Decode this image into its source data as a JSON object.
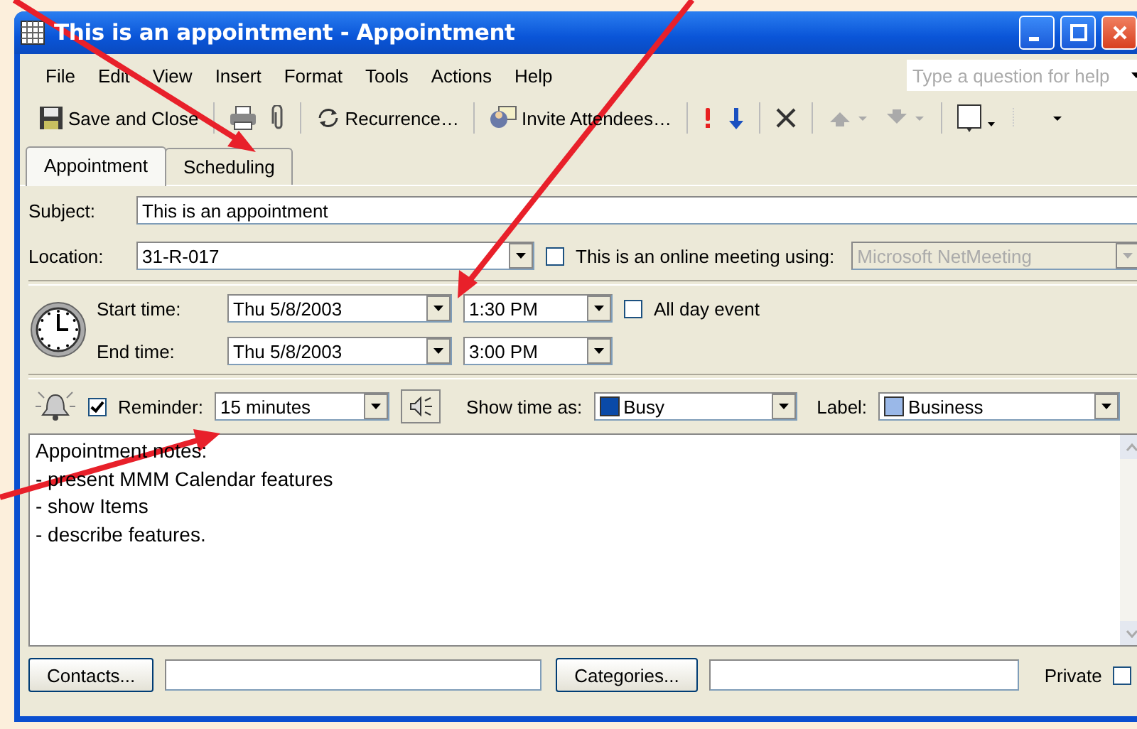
{
  "window": {
    "title": "This is an appointment - Appointment"
  },
  "menu": [
    "File",
    "Edit",
    "View",
    "Insert",
    "Format",
    "Tools",
    "Actions",
    "Help"
  ],
  "help_box": {
    "placeholder": "Type a question for help"
  },
  "toolbar": [
    {
      "kind": "save",
      "label": "Save and Close"
    },
    {
      "kind": "print"
    },
    {
      "kind": "attach"
    },
    {
      "kind": "recurrence",
      "label": "Recurrence…"
    },
    {
      "kind": "invite",
      "label": "Invite Attendees…"
    },
    {
      "kind": "high-importance"
    },
    {
      "kind": "low-importance"
    },
    {
      "kind": "delete"
    },
    {
      "kind": "previous",
      "disabled": true
    },
    {
      "kind": "next",
      "disabled": true
    },
    {
      "kind": "help"
    }
  ],
  "tabs": [
    {
      "label": "Appointment",
      "selected": true
    },
    {
      "label": "Scheduling",
      "selected": false
    }
  ],
  "subject": {
    "label": "Subject:",
    "value": "This is an appointment"
  },
  "location": {
    "label": "Location:",
    "value": "31-R-017"
  },
  "online_meeting": {
    "label": "This is an online meeting using:",
    "checked": false,
    "value": "Microsoft NetMeeting",
    "disabled": true
  },
  "start": {
    "label": "Start time:",
    "date": "Thu 5/8/2003",
    "time": "1:30 PM"
  },
  "end": {
    "label": "End time:",
    "date": "Thu 5/8/2003",
    "time": "3:00 PM"
  },
  "all_day": {
    "label": "All day event",
    "checked": false
  },
  "reminder": {
    "label": "Reminder:",
    "checked": true,
    "value": "15 minutes"
  },
  "show_time_as": {
    "label": "Show time as:",
    "value": "Busy"
  },
  "label_field": {
    "label": "Label:",
    "value": "Business"
  },
  "notes": [
    "Appointment notes:",
    "- present MMM Calendar features",
    "- show Items",
    "- describe features."
  ],
  "footer": {
    "contacts_button": "Contacts...",
    "categories_button": "Categories...",
    "private": {
      "label": "Private",
      "checked": false
    }
  }
}
